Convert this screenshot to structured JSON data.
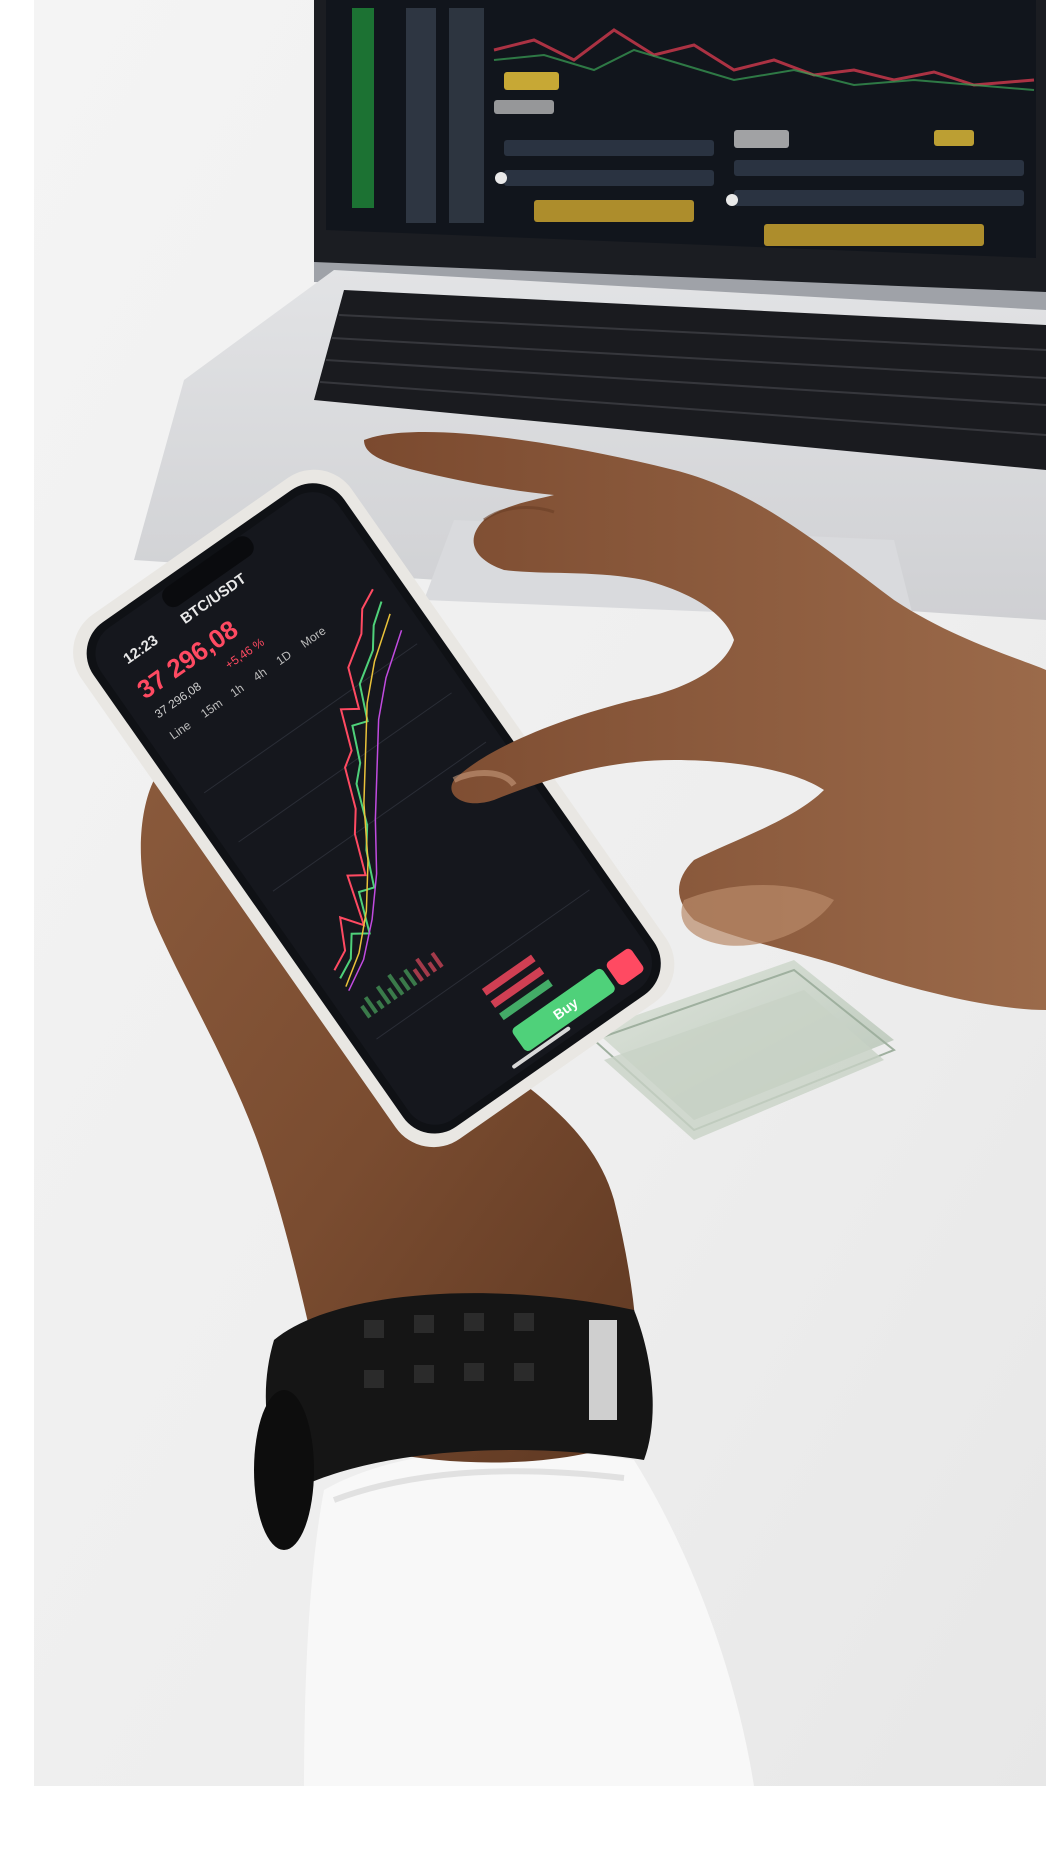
{
  "photo": {
    "subject": "hands holding smartphone with trading app in front of laptop"
  },
  "phone_screen": {
    "time": "12:23",
    "pair": "BTC/USDT",
    "price": "37 296,08",
    "subprice": "37 296,08",
    "change": "+5,46 %",
    "timeframes": [
      "Line",
      "15m",
      "1h",
      "4h",
      "1D",
      "More"
    ],
    "buy_label": "Buy"
  },
  "colors": {
    "background": "#f1f1f1",
    "screen": "#15171d",
    "price_red": "#ff4a62",
    "buy_green": "#4fd17a"
  }
}
